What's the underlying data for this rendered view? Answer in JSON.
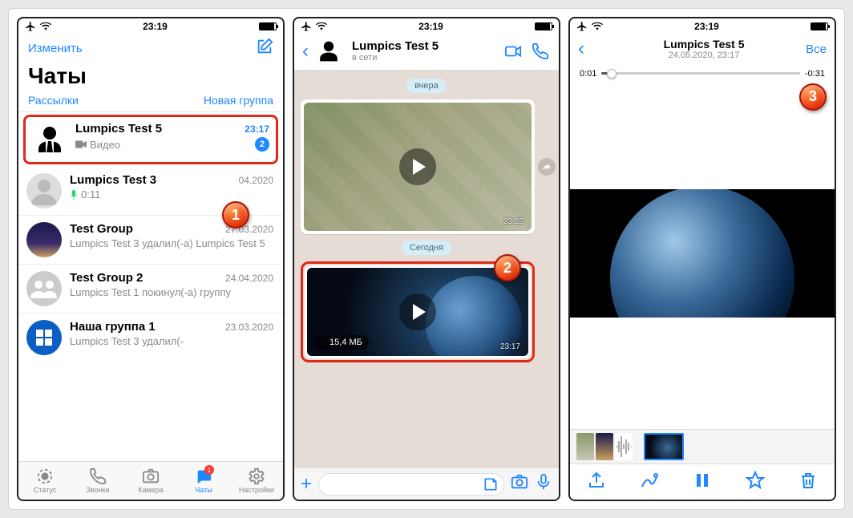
{
  "status": {
    "time": "23:19"
  },
  "screen1": {
    "edit": "Изменить",
    "title": "Чаты",
    "broadcasts": "Рассылки",
    "new_group": "Новая группа",
    "chats": [
      {
        "name": "Lumpics Test 5",
        "time": "23:17",
        "preview": "Видео",
        "badge": "2",
        "time_blue": true
      },
      {
        "name": "Lumpics Test 3",
        "time": "04.2020",
        "preview": "0:11",
        "voice": true
      },
      {
        "name": "Test Group",
        "time": "27.03.2020",
        "preview": "Lumpics Test 3 удалил(-а) Lumpics Test 5"
      },
      {
        "name": "Test Group 2",
        "time": "24.04.2020",
        "preview": "Lumpics Test 1 покинул(-а) группу"
      },
      {
        "name": "Наша группа 1",
        "time": "23.03.2020",
        "preview": "Lumpics Test 3 удалил(-"
      }
    ],
    "tabs": {
      "status": "Статус",
      "calls": "Звонки",
      "camera": "Камера",
      "chats": "Чаты",
      "settings": "Настройки",
      "chat_badge": "1"
    }
  },
  "screen2": {
    "title": "Lumpics Test 5",
    "subtitle": "в сети",
    "day1": "вчера",
    "msg1_time": "23:22",
    "day2": "Сегодня",
    "msg2_size": "15,4 МБ",
    "msg2_time": "23:17"
  },
  "screen3": {
    "title": "Lumpics Test 5",
    "date": "24.05.2020, 23:17",
    "all": "Все",
    "elapsed": "0:01",
    "remaining": "-0:31"
  },
  "steps": {
    "s1": "1",
    "s2": "2",
    "s3": "3"
  }
}
